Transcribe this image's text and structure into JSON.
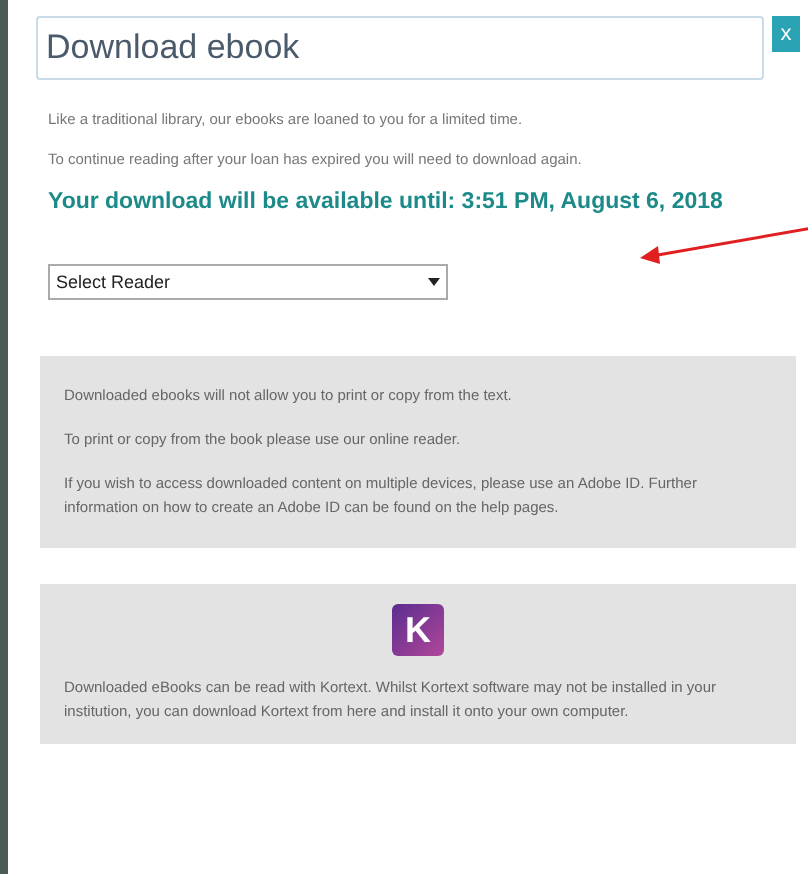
{
  "dialog": {
    "title": "Download ebook",
    "close_label": "x"
  },
  "intro": [
    "Like a traditional library, our ebooks are loaned to you for a limited time.",
    "To continue reading after your loan has expired you will need to download again."
  ],
  "availability": "Your download will be available until: 3:51 PM, August 6, 2018",
  "reader_select": {
    "value": "Select Reader"
  },
  "notice_box": [
    "Downloaded ebooks will not allow you to print or copy from the text.",
    "To print or copy from the book please use our online reader.",
    "If you wish to access downloaded content on multiple devices, please use an Adobe ID. Further information on how to create an Adobe ID can be found on the help pages."
  ],
  "kortext_box": {
    "icon_letter": "K",
    "text": "Downloaded eBooks can be read with Kortext. Whilst Kortext software may not be installed in your institution, you can download Kortext from here and install it onto your own computer."
  }
}
